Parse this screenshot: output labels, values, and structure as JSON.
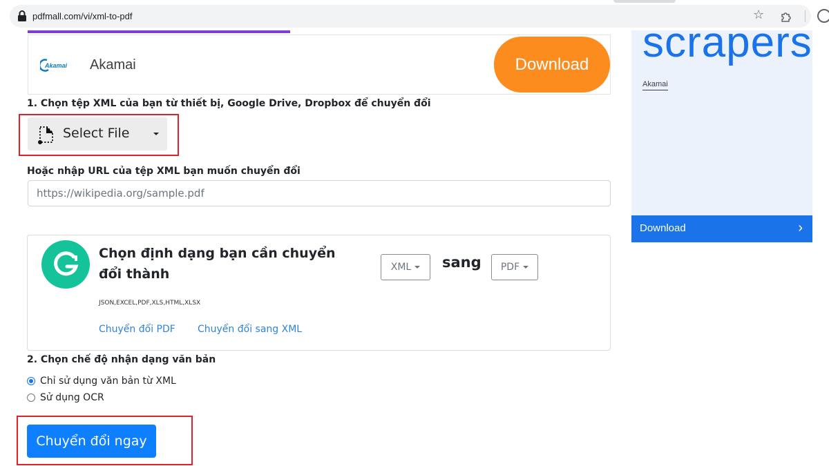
{
  "browser": {
    "url": "pdfmall.com/vi/xml-to-pdf",
    "icons": [
      "lock-icon",
      "star-icon",
      "extensions-icon",
      "profile-icon"
    ]
  },
  "ad_banner": {
    "logo_text": "Akamai",
    "name": "Akamai",
    "button_label": "Download",
    "button_color": "#fb8c1d"
  },
  "side_ad": {
    "headline": "scrapers",
    "brand": "Akamai",
    "button_label": "Download",
    "chevron": "›",
    "accent_color": "#1a73e8"
  },
  "step1": {
    "heading": "1. Chọn tệp XML của bạn từ thiết bị, Google Drive, Dropbox để chuyển đổi",
    "select_file_label": "Select File"
  },
  "url_section": {
    "heading": "Hoặc nhập URL của tệp XML bạn muốn chuyển đổi",
    "placeholder": "https://wikipedia.org/sample.pdf",
    "value": ""
  },
  "format_card": {
    "title": "Chọn định dạng bạn cần chuyển đổi thành",
    "formats": "JSON,EXCEL,PDF,XLS,HTML,XLSX",
    "from_format": "XML",
    "connector": "sang",
    "to_format": "PDF",
    "links": [
      "Chuyển đổi PDF",
      "Chuyển đổi sang XML"
    ]
  },
  "step2": {
    "heading": "2. Chọn chế độ nhận dạng văn bản",
    "options": [
      {
        "label": "Chỉ sử dụng văn bản từ XML",
        "selected": true
      },
      {
        "label": "Sử dụng OCR",
        "selected": false
      }
    ]
  },
  "convert_button": {
    "label": "Chuyển đổi ngay",
    "color": "#0d7fff"
  },
  "highlight_color": "#e0202b"
}
